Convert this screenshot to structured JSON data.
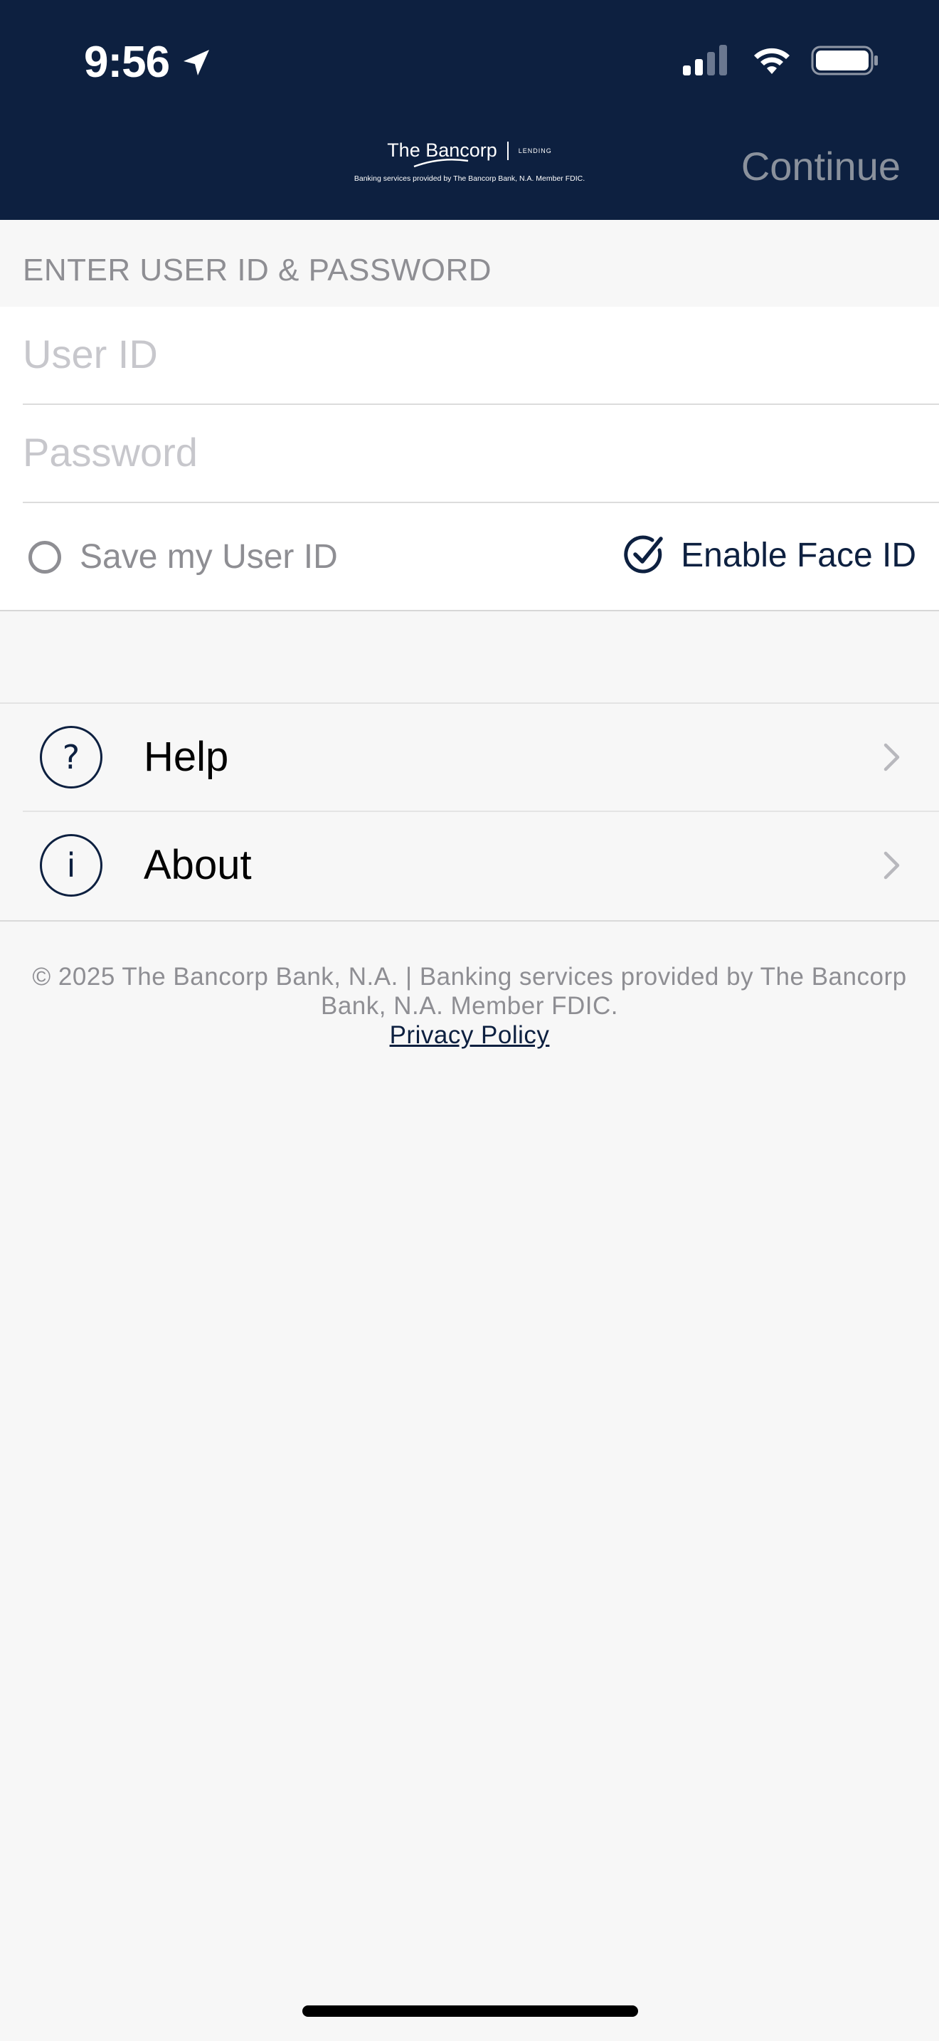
{
  "status_bar": {
    "time": "9:56",
    "icons": [
      "location-arrow-icon",
      "cellular-signal-icon",
      "wifi-icon",
      "battery-icon"
    ]
  },
  "header": {
    "logo_name": "The Bancorp",
    "logo_tag": "LENDING",
    "logo_subtitle": "Banking services provided by The Bancorp Bank, N.A. Member FDIC.",
    "continue_label": "Continue"
  },
  "login": {
    "section_title": "ENTER USER ID & PASSWORD",
    "user_id_placeholder": "User ID",
    "user_id_value": "",
    "password_placeholder": "Password",
    "password_value": "",
    "save_user_id_label": "Save my User ID",
    "save_user_id_checked": false,
    "face_id_label": "Enable Face ID",
    "face_id_checked": true
  },
  "menu": {
    "items": [
      {
        "label": "Help",
        "icon": "question-icon",
        "glyph": "?"
      },
      {
        "label": "About",
        "icon": "info-icon",
        "glyph": "i"
      }
    ]
  },
  "footer": {
    "copyright": "© 2025 The Bancorp Bank, N.A. | Banking services provided by The Bancorp Bank, N.A. Member FDIC.",
    "privacy_link": "Privacy Policy"
  },
  "colors": {
    "navy": "#0d2040",
    "background": "#f7f7f7",
    "muted_text": "#8e8e93",
    "placeholder": "#c7c7cc"
  }
}
